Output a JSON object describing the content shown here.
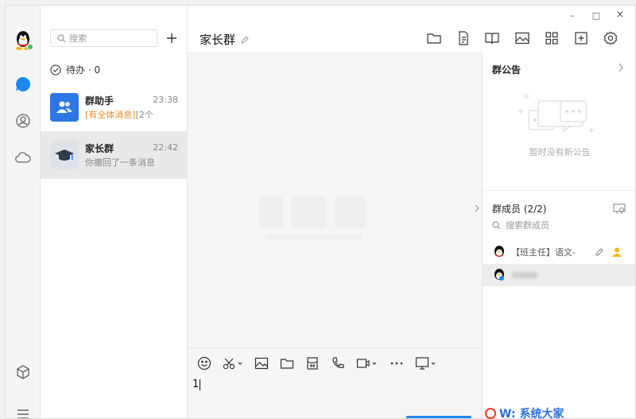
{
  "window_controls": {
    "minimize": "–",
    "maximize": "□",
    "close": "×"
  },
  "search": {
    "placeholder": "搜索"
  },
  "todo": {
    "label": "待办 · 0"
  },
  "conversations": [
    {
      "name": "群助手",
      "time": "23:38",
      "highlight": "[有全体消息]",
      "preview": "[2个"
    },
    {
      "name": "家长群",
      "time": "22:42",
      "highlight": "",
      "preview": "你撤回了一条消息"
    }
  ],
  "chat": {
    "title": "家长群",
    "input_text": "1"
  },
  "panel": {
    "notice_title": "群公告",
    "notice_empty": "暂时没有新公告",
    "members_title": "群成员 (2/2)",
    "member_search_placeholder": "搜索群成员",
    "members": [
      {
        "label": "【班主任】语文-"
      },
      {
        "label": ""
      }
    ]
  },
  "brand_text": "W: 系统大家",
  "colors": {
    "accent": "#1e87f0",
    "group_helper": "#2b78e4",
    "highlight": "#f08a24"
  },
  "icons": {
    "rail": [
      "qq-penguin-avatar",
      "chat-bubble-icon",
      "contacts-icon",
      "cloud-icon",
      "cube-icon",
      "menu-icon"
    ],
    "toolbar": [
      "folder-icon",
      "document-icon",
      "book-icon",
      "image-icon",
      "grid-apps-icon",
      "add-frame-icon",
      "settings-icon"
    ],
    "composer": [
      "emoji-icon",
      "scissors-icon",
      "image-icon",
      "folder-icon",
      "red-envelope-icon",
      "phone-icon",
      "video-icon",
      "more-icon",
      "screen-share-icon"
    ]
  }
}
